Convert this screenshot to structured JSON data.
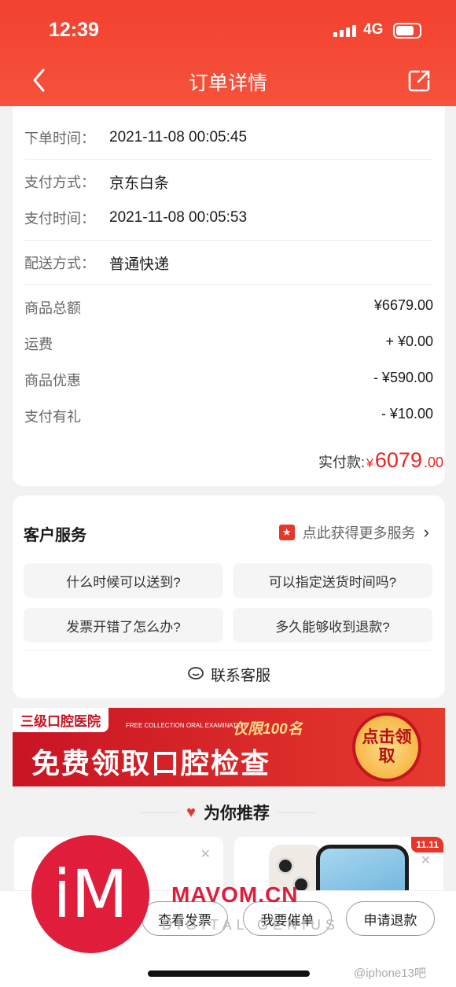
{
  "status": {
    "time": "12:39",
    "network": "4G"
  },
  "nav": {
    "title": "订单详情"
  },
  "order": {
    "rows": [
      {
        "label": "下单时间：",
        "value": "2021-11-08 00:05:45"
      },
      {
        "label": "支付方式：",
        "value": "京东白条"
      },
      {
        "label": "支付时间：",
        "value": "2021-11-08 00:05:53"
      },
      {
        "label": "配送方式：",
        "value": "普通快递"
      }
    ],
    "amounts": [
      {
        "label": "商品总额",
        "value": "¥6679.00"
      },
      {
        "label": "运费",
        "value": "+ ¥0.00"
      },
      {
        "label": "商品优惠",
        "value": "- ¥590.00"
      },
      {
        "label": "支付有礼",
        "value": "- ¥10.00"
      }
    ],
    "paid_label": "实付款:",
    "paid_currency": "¥",
    "paid_int": "6079",
    "paid_dec": ".00"
  },
  "service": {
    "title": "客户服务",
    "more_label": "点此获得更多服务",
    "questions": [
      "什么时候可以送到?",
      "可以指定送货时间吗?",
      "发票开错了怎么办?",
      "多久能够收到退款?"
    ],
    "contact_label": "联系客服"
  },
  "banner": {
    "tag": "三级口腔医院",
    "headline": "免费领取口腔检查",
    "limit": "仅限100名",
    "small": "FREE COLLECTION ORAL EXAMINATION",
    "cta": "点击领取"
  },
  "recommend": {
    "title": "为你推荐",
    "badge": "11.11"
  },
  "bottom_bar": {
    "buttons": [
      "查看发票",
      "我要催单",
      "申请退款"
    ]
  },
  "watermark": {
    "logo_letter": "iM",
    "site": "MAVOM.CN",
    "sub": "DIGITAL GENIUS",
    "handle": "@iphone13吧"
  }
}
